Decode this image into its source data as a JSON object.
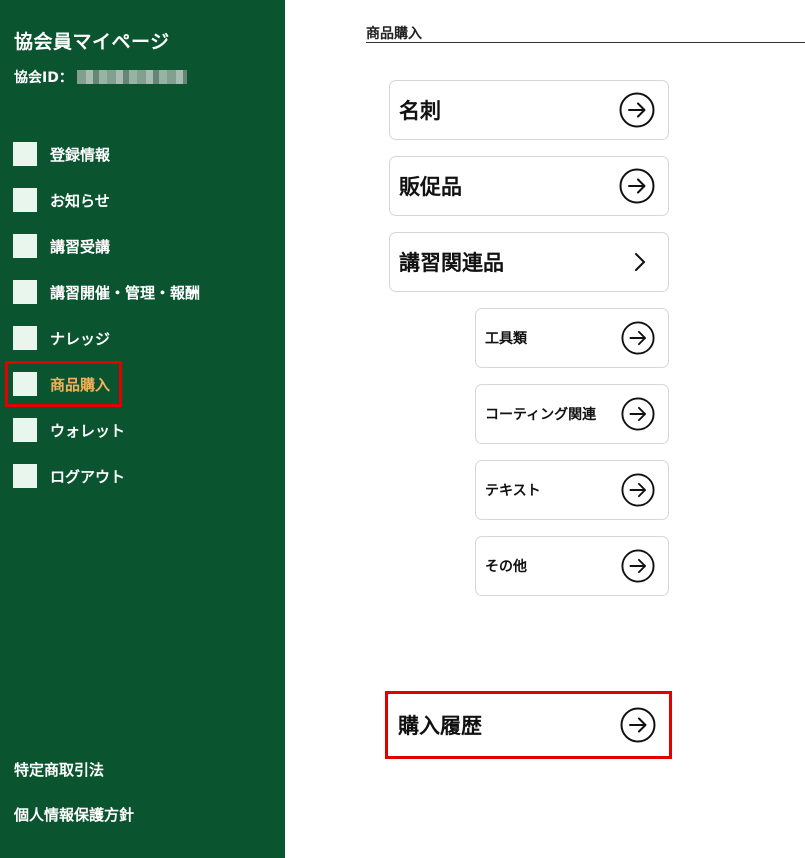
{
  "sidebar": {
    "title": "協会員マイページ",
    "id_label": "協会ID：",
    "items": [
      {
        "label": "登録情報"
      },
      {
        "label": "お知らせ"
      },
      {
        "label": "講習受講"
      },
      {
        "label": "講習開催・管理・報酬"
      },
      {
        "label": "ナレッジ"
      },
      {
        "label": "商品購入"
      },
      {
        "label": "ウォレット"
      },
      {
        "label": "ログアウト"
      }
    ],
    "footer": {
      "legal": "特定商取引法",
      "privacy": "個人情報保護方針"
    }
  },
  "main": {
    "section_title": "商品購入",
    "cards": [
      {
        "label": "名刺"
      },
      {
        "label": "販促品"
      },
      {
        "label": "講習関連品"
      }
    ],
    "sub_cards": [
      {
        "label": "工具類"
      },
      {
        "label": "コーティング関連"
      },
      {
        "label": "テキスト"
      },
      {
        "label": "その他"
      }
    ],
    "history": {
      "label": "購入履歴"
    }
  },
  "colors": {
    "sidebar_bg": "#0b5430",
    "active_label": "#f2b25a",
    "highlight": "#e00000"
  },
  "icons": {
    "arrow": "circle-arrow-right-icon",
    "chevron": "chevron-right-icon"
  }
}
